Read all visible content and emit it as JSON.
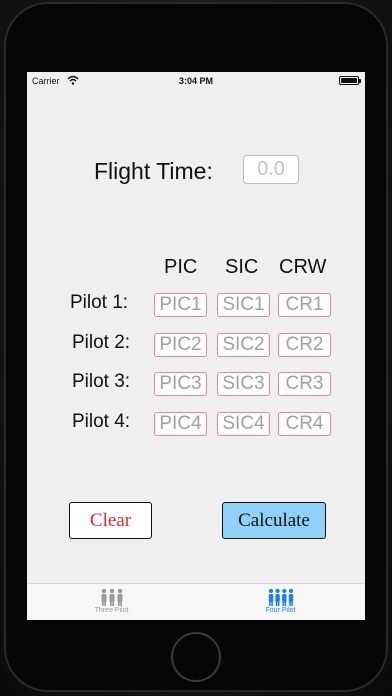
{
  "status_bar": {
    "carrier": "Carrier",
    "time": "3:04 PM",
    "battery_level": 1.0
  },
  "flight_time": {
    "label": "Flight Time:",
    "placeholder": "0.0"
  },
  "columns": [
    "PIC",
    "SIC",
    "CRW"
  ],
  "rows": [
    {
      "label": "Pilot 1:",
      "cells": [
        "PIC1",
        "SIC1",
        "CR1"
      ]
    },
    {
      "label": "Pilot 2:",
      "cells": [
        "PIC2",
        "SIC2",
        "CR2"
      ]
    },
    {
      "label": "Pilot 3:",
      "cells": [
        "PIC3",
        "SIC3",
        "CR3"
      ]
    },
    {
      "label": "Pilot 4:",
      "cells": [
        "PIC4",
        "SIC4",
        "CR4"
      ]
    }
  ],
  "buttons": {
    "clear": "Clear",
    "calculate": "Calculate"
  },
  "tabs": [
    {
      "label": "Three Pilot",
      "icon": "three-pilots-icon",
      "selected": false
    },
    {
      "label": "Four Pilot",
      "icon": "four-pilots-icon",
      "selected": true
    }
  ],
  "colors": {
    "accent": "#1a7ef5",
    "inactive_tab": "#9b9b9b",
    "clear_text": "#e0262a",
    "calculate_bg": "#8ed0f6",
    "cell_border": "#e08898"
  }
}
